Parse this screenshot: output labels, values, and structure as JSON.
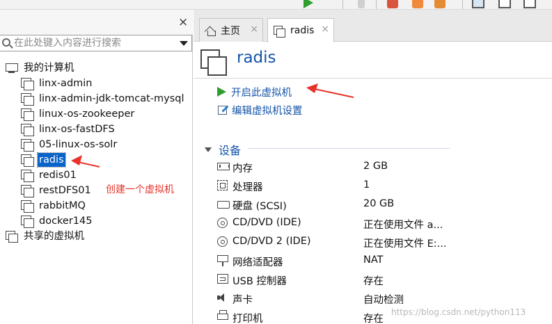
{
  "library": {
    "close_label": "×",
    "search_placeholder": "在此处键入内容进行搜索",
    "tree": {
      "root_label": "我的计算机",
      "vms": [
        {
          "label": "linx-admin"
        },
        {
          "label": "linx-admin-jdk-tomcat-mysql"
        },
        {
          "label": "linux-os-zookeeper"
        },
        {
          "label": "linx-os-fastDFS"
        },
        {
          "label": "05-linux-os-solr"
        },
        {
          "label": "radis",
          "selected": true
        },
        {
          "label": "redis01"
        },
        {
          "label": "restDFS01"
        },
        {
          "label": "rabbitMQ"
        },
        {
          "label": "docker145"
        }
      ],
      "shared_label": "共享的虚拟机"
    }
  },
  "annotation": {
    "text": "创建一个虚拟机",
    "color": "#e8322a"
  },
  "tabs": [
    {
      "label": "主页",
      "icon": "home-icon",
      "close": "×"
    },
    {
      "label": "radis",
      "icon": "vm-icon",
      "close": "×",
      "active": true
    }
  ],
  "vm": {
    "title": "radis",
    "actions": {
      "power_on": "开启此虚拟机",
      "edit_settings": "编辑虚拟机设置"
    },
    "devices_section": "设备",
    "devices": [
      {
        "name": "内存",
        "value": "2 GB",
        "icon": "memory-icon"
      },
      {
        "name": "处理器",
        "value": "1",
        "icon": "processor-icon"
      },
      {
        "name": "硬盘 (SCSI)",
        "value": "20 GB",
        "icon": "hard-disk-icon"
      },
      {
        "name": "CD/DVD (IDE)",
        "value": "正在使用文件 a...",
        "icon": "cd-dvd-icon"
      },
      {
        "name": "CD/DVD 2 (IDE)",
        "value": "正在使用文件 E:...",
        "icon": "cd-dvd-icon"
      },
      {
        "name": "网络适配器",
        "value": "NAT",
        "icon": "network-adapter-icon"
      },
      {
        "name": "USB 控制器",
        "value": "存在",
        "icon": "usb-controller-icon"
      },
      {
        "name": "声卡",
        "value": "自动检测",
        "icon": "sound-card-icon"
      },
      {
        "name": "打印机",
        "value": "存在",
        "icon": "printer-icon"
      }
    ]
  },
  "watermark": "https://blog.csdn.net/python113",
  "colors": {
    "accent": "#1554a8",
    "selection": "#0a63c9",
    "play": "#2f9e2f"
  }
}
